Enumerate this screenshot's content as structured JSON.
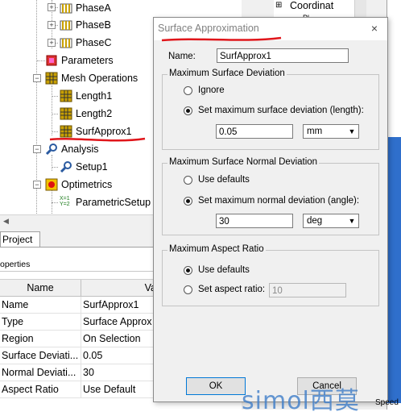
{
  "tree": {
    "items": [
      {
        "label": "PhaseA",
        "icon": "coil-icon"
      },
      {
        "label": "PhaseB",
        "icon": "coil-icon"
      },
      {
        "label": "PhaseC",
        "icon": "coil-icon"
      },
      {
        "label": "Parameters",
        "icon": "parameters-icon"
      },
      {
        "label": "Mesh Operations",
        "icon": "mesh-icon"
      },
      {
        "label": "Length1",
        "icon": "mesh-icon"
      },
      {
        "label": "Length2",
        "icon": "mesh-icon"
      },
      {
        "label": "SurfApprox1",
        "icon": "mesh-icon"
      },
      {
        "label": "Analysis",
        "icon": "analysis-icon"
      },
      {
        "label": "Setup1",
        "icon": "analysis-icon"
      },
      {
        "label": "Optimetrics",
        "icon": "optimetrics-icon"
      },
      {
        "label": "ParametricSetup",
        "icon": "parametric-icon"
      }
    ],
    "right_item": "Coordinat",
    "right_item_partial": "Pl"
  },
  "tabs": {
    "project": "Project"
  },
  "properties": {
    "title": "operties",
    "headers": [
      "Name",
      "Va"
    ],
    "rows": [
      [
        "Name",
        "SurfApprox1"
      ],
      [
        "Type",
        "Surface Approx"
      ],
      [
        "Region",
        "On Selection"
      ],
      [
        "Surface Deviati...",
        "0.05"
      ],
      [
        "Normal Deviati...",
        "30"
      ],
      [
        "Aspect Ratio",
        "Use Default"
      ]
    ]
  },
  "dialog": {
    "title": "Surface Approximation",
    "close": "×",
    "name_label": "Name:",
    "name_value": "SurfApprox1",
    "surface_dev": {
      "legend": "Maximum Surface Deviation",
      "ignore": "Ignore",
      "set": "Set maximum surface deviation (length):",
      "value": "0.05",
      "unit": "mm",
      "selected": "set"
    },
    "normal_dev": {
      "legend": "Maximum Surface Normal Deviation",
      "defaults": "Use defaults",
      "set": "Set maximum normal deviation (angle):",
      "value": "30",
      "unit": "deg",
      "selected": "set"
    },
    "aspect": {
      "legend": "Maximum Aspect Ratio",
      "defaults": "Use defaults",
      "set": "Set aspect ratio:",
      "value": "10",
      "selected": "defaults"
    },
    "ok": "OK",
    "cancel": "Cancel"
  },
  "watermark": "simol西莫",
  "speed_label": "Speed",
  "colors": {
    "annotation_red": "#e0161b",
    "accent_blue": "#0078d7"
  }
}
